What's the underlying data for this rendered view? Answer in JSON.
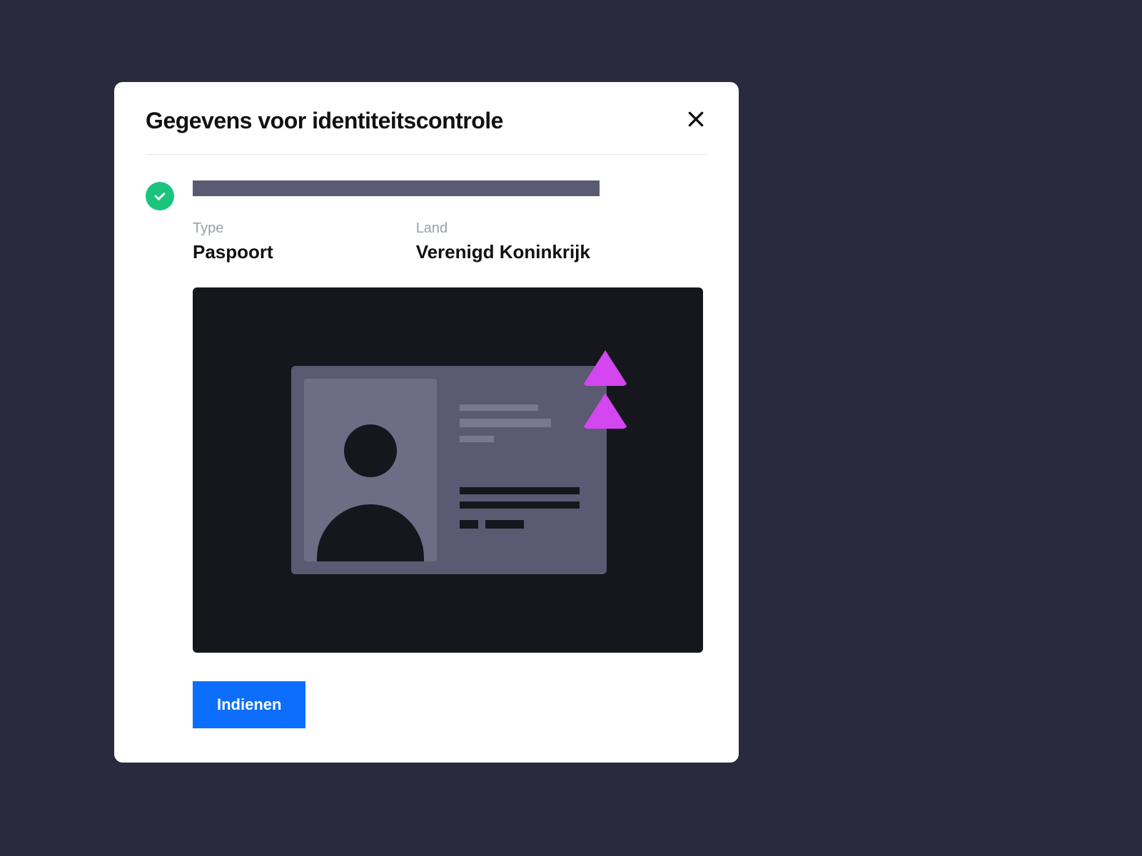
{
  "modal": {
    "title": "Gegevens voor identiteitscontrole",
    "type_label": "Type",
    "type_value": "Paspoort",
    "country_label": "Land",
    "country_value": "Verenigd Koninkrijk",
    "submit_label": "Indienen"
  }
}
